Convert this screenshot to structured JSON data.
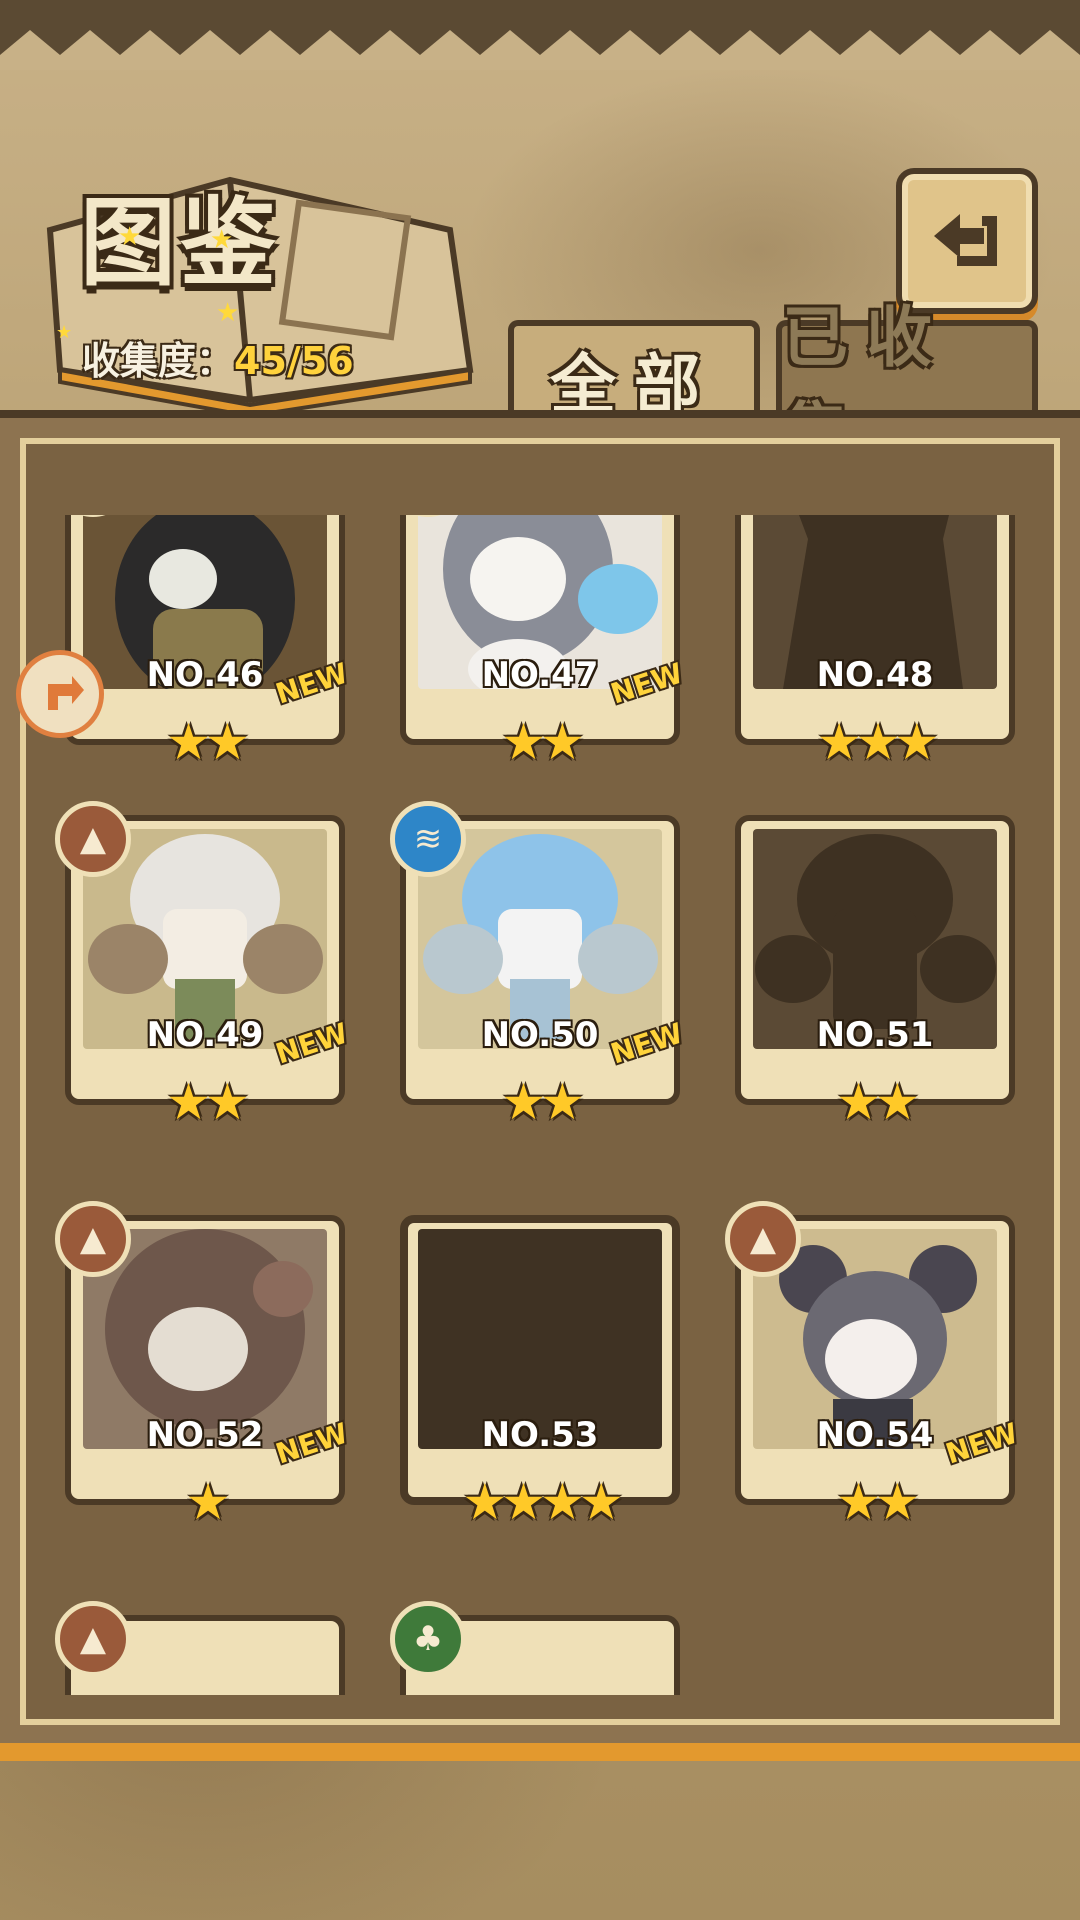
{
  "header": {
    "title": "图鉴",
    "collection_label": "收集度：",
    "collection_value": "45/56"
  },
  "tabs": [
    {
      "label": "全部",
      "active": true
    },
    {
      "label": "已收集",
      "active": false
    }
  ],
  "icons": {
    "back": "back-arrow-icon",
    "side": "side-arrow-icon"
  },
  "cards": [
    {
      "no": "NO.46",
      "stars": "★★",
      "new": "NEW",
      "element": "earth",
      "state": "revealed"
    },
    {
      "no": "NO.47",
      "stars": "★★",
      "new": "NEW",
      "element": "water",
      "state": "revealed"
    },
    {
      "no": "NO.48",
      "stars": "★★★",
      "new": "",
      "element": "",
      "state": "silhouette"
    },
    {
      "no": "NO.49",
      "stars": "★★",
      "new": "NEW",
      "element": "earth",
      "state": "revealed"
    },
    {
      "no": "NO.50",
      "stars": "★★",
      "new": "NEW",
      "element": "water",
      "state": "revealed"
    },
    {
      "no": "NO.51",
      "stars": "★★",
      "new": "",
      "element": "",
      "state": "silhouette"
    },
    {
      "no": "NO.52",
      "stars": "★",
      "new": "NEW",
      "element": "earth",
      "state": "revealed"
    },
    {
      "no": "NO.53",
      "stars": "★★★★",
      "new": "",
      "element": "",
      "state": "locked"
    },
    {
      "no": "NO.54",
      "stars": "★★",
      "new": "NEW",
      "element": "earth",
      "state": "revealed"
    }
  ],
  "colors": {
    "accent_yellow": "#ffd23c",
    "frame_dark": "#4b3a26",
    "plate": "#efe0b7"
  }
}
